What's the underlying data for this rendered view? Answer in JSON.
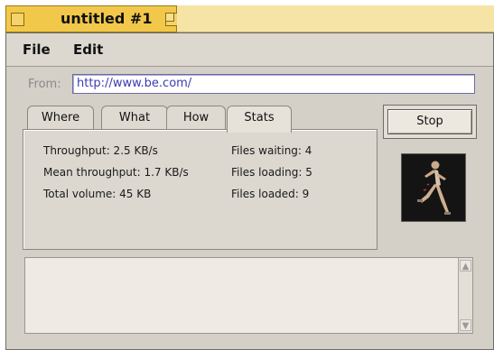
{
  "window": {
    "title": "untitled #1"
  },
  "menu": {
    "file": "File",
    "edit": "Edit"
  },
  "address": {
    "label": "From:",
    "url": "http://www.be.com/"
  },
  "tabs": [
    "Where",
    "What",
    "How",
    "Stats"
  ],
  "active_tab": "Stats",
  "stats": {
    "throughput": "Throughput: 2.5 KB/s",
    "mean_throughput": "Mean throughput: 1.7 KB/s",
    "total_volume": "Total volume: 45 KB",
    "files_waiting": "Files waiting: 4",
    "files_loading": "Files loading: 5",
    "files_loaded": "Files loaded: 9"
  },
  "stop_button": "Stop",
  "log_text": "",
  "icons": {
    "close": "close-box-icon",
    "zoom": "zoom-box-icon",
    "scroll_up": "scroll-up-arrow-icon",
    "scroll_down": "scroll-down-arrow-icon",
    "animation": "running-figure-icon"
  },
  "colors": {
    "title_tab": "#f2c84a",
    "window_bg": "#d4d0c8",
    "url_text": "#3b3bb0"
  }
}
